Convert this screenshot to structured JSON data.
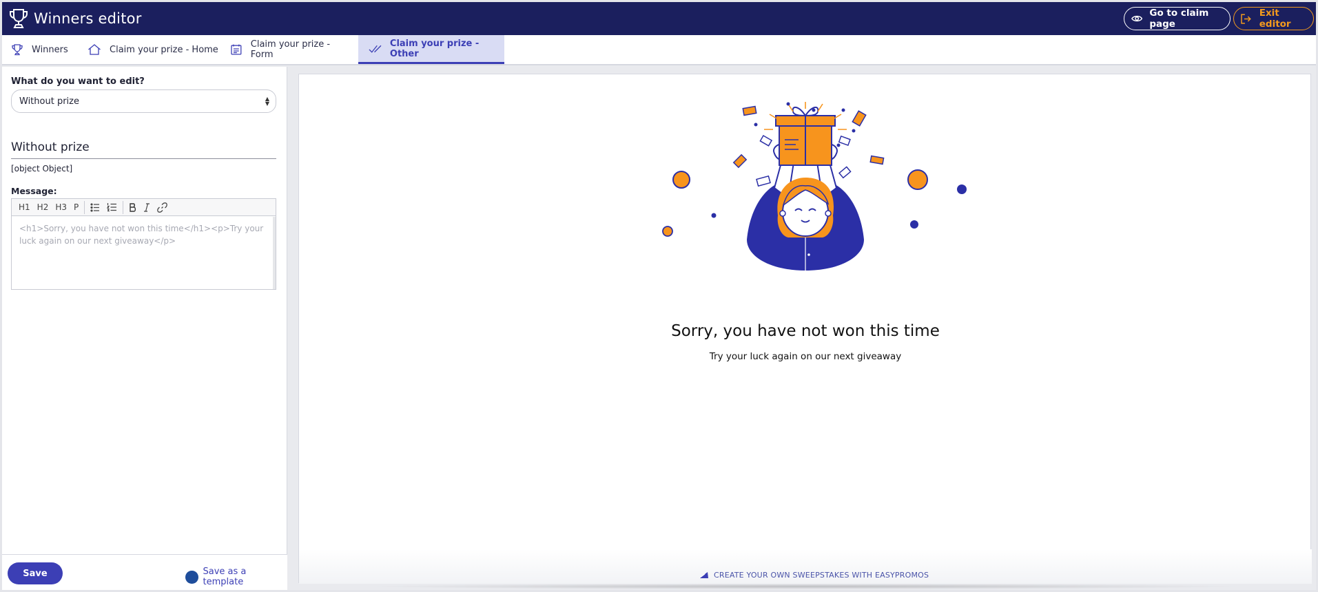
{
  "header": {
    "title": "Winners editor",
    "go_to_claim_label": "Go to claim page",
    "exit_label": "Exit editor",
    "bg_color": "#1b1f5e",
    "exit_color": "#f39a1d"
  },
  "tabs": [
    {
      "label": "Winners",
      "icon": "trophy-icon"
    },
    {
      "label": "Claim your prize - Home",
      "icon": "home-icon"
    },
    {
      "label": "Claim your prize - Form",
      "icon": "form-icon"
    },
    {
      "label": "Claim your prize - Other",
      "icon": "check-icon",
      "active": true
    }
  ],
  "left_panel": {
    "edit_label": "What do you want to edit?",
    "select_value": "Without prize",
    "section_title": "Without prize",
    "object_text": "[object Object]",
    "message_label": "Message:",
    "toolbar": [
      "H1",
      "H2",
      "H3",
      "P"
    ],
    "message_placeholder": "<h1>Sorry, you have not won this time</h1><p>Try your luck again on our next giveaway</p>",
    "save_label": "Save",
    "save_template_label": "Save as a template"
  },
  "preview": {
    "title": "Sorry, you have not won this time",
    "subtitle": "Try your luck again on our next giveaway",
    "footer_link": "CREATE YOUR OWN SWEEPSTAKES WITH EASYPROMOS",
    "accent_orange": "#f7941d",
    "accent_blue": "#2b2fa6"
  }
}
